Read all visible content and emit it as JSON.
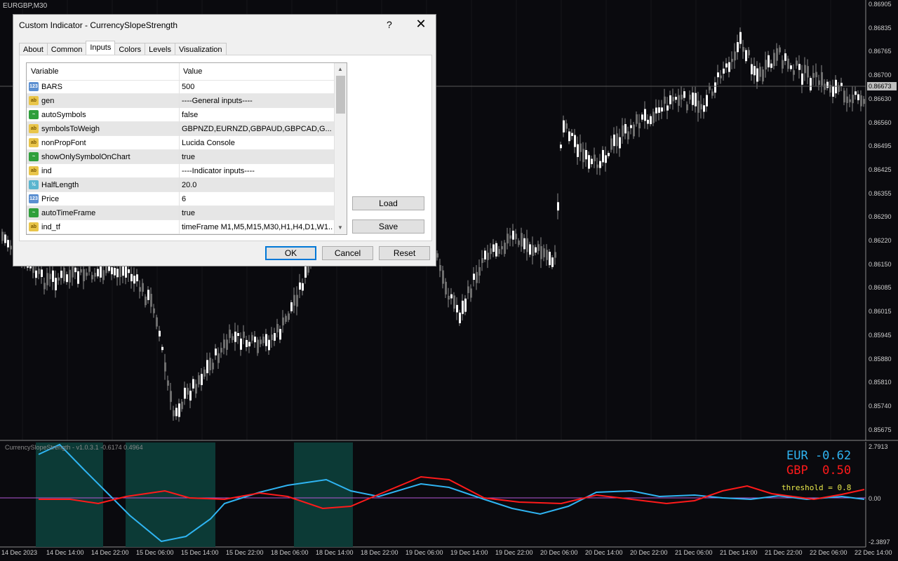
{
  "chart": {
    "title": "EURGBP,M30",
    "price_labels": [
      "0.86905",
      "0.86835",
      "0.86765",
      "0.86700",
      "0.86630",
      "0.86560",
      "0.86495",
      "0.86425",
      "0.86355",
      "0.86290",
      "0.86220",
      "0.86150",
      "0.86085",
      "0.86015",
      "0.85945",
      "0.85880",
      "0.85810",
      "0.85740",
      "0.85675"
    ],
    "current_price": "0.86673",
    "time_labels": [
      "14 Dec 2023",
      "14 Dec 14:00",
      "14 Dec 22:00",
      "15 Dec 06:00",
      "15 Dec 14:00",
      "15 Dec 22:00",
      "18 Dec 06:00",
      "18 Dec 14:00",
      "18 Dec 22:00",
      "19 Dec 06:00",
      "19 Dec 14:00",
      "19 Dec 22:00",
      "20 Dec 06:00",
      "20 Dec 14:00",
      "20 Dec 22:00",
      "21 Dec 06:00",
      "21 Dec 14:00",
      "21 Dec 22:00",
      "22 Dec 06:00",
      "22 Dec 14:00"
    ]
  },
  "indicator": {
    "title": "CurrencySlopeStrength - v1.0.3.1 -0.6174 0.4964",
    "y_top": "2.7913",
    "y_zero": "0.00",
    "y_bottom": "-2.3897",
    "eur_label": "EUR -0.62",
    "gbp_label": "GBP  0.50",
    "threshold_label": "threshold = 0.8",
    "eur_color": "#2fb4f2",
    "gbp_color": "#ff1a1a"
  },
  "dialog": {
    "title": "Custom Indicator - CurrencySlopeStrength",
    "help": "?",
    "close": "✕",
    "tabs": [
      "About",
      "Common",
      "Inputs",
      "Colors",
      "Levels",
      "Visualization"
    ],
    "active_tab": "Inputs",
    "columns": [
      "Variable",
      "Value"
    ],
    "rows": [
      {
        "icon": "123",
        "type": "num",
        "name": "BARS",
        "value": "500"
      },
      {
        "icon": "ab",
        "type": "txt",
        "name": "gen",
        "value": "----General inputs----"
      },
      {
        "icon": "~",
        "type": "bool",
        "name": "autoSymbols",
        "value": "false"
      },
      {
        "icon": "ab",
        "type": "txt",
        "name": "symbolsToWeigh",
        "value": "GBPNZD,EURNZD,GBPAUD,GBPCAD,G..."
      },
      {
        "icon": "ab",
        "type": "txt",
        "name": "nonPropFont",
        "value": "Lucida Console"
      },
      {
        "icon": "~",
        "type": "bool",
        "name": "showOnlySymbolOnChart",
        "value": "true"
      },
      {
        "icon": "ab",
        "type": "txt",
        "name": "ind",
        "value": "----Indicator inputs----"
      },
      {
        "icon": "½",
        "type": "dbl",
        "name": "HalfLength",
        "value": "20.0"
      },
      {
        "icon": "123",
        "type": "num",
        "name": "Price",
        "value": "6"
      },
      {
        "icon": "~",
        "type": "bool",
        "name": "autoTimeFrame",
        "value": "true"
      },
      {
        "icon": "ab",
        "type": "txt",
        "name": "ind_tf",
        "value": "timeFrame M1,M5,M15,M30,H1,H4,D1,W1..."
      }
    ],
    "load_label": "Load",
    "save_label": "Save",
    "ok_label": "OK",
    "cancel_label": "Cancel",
    "reset_label": "Reset"
  }
}
